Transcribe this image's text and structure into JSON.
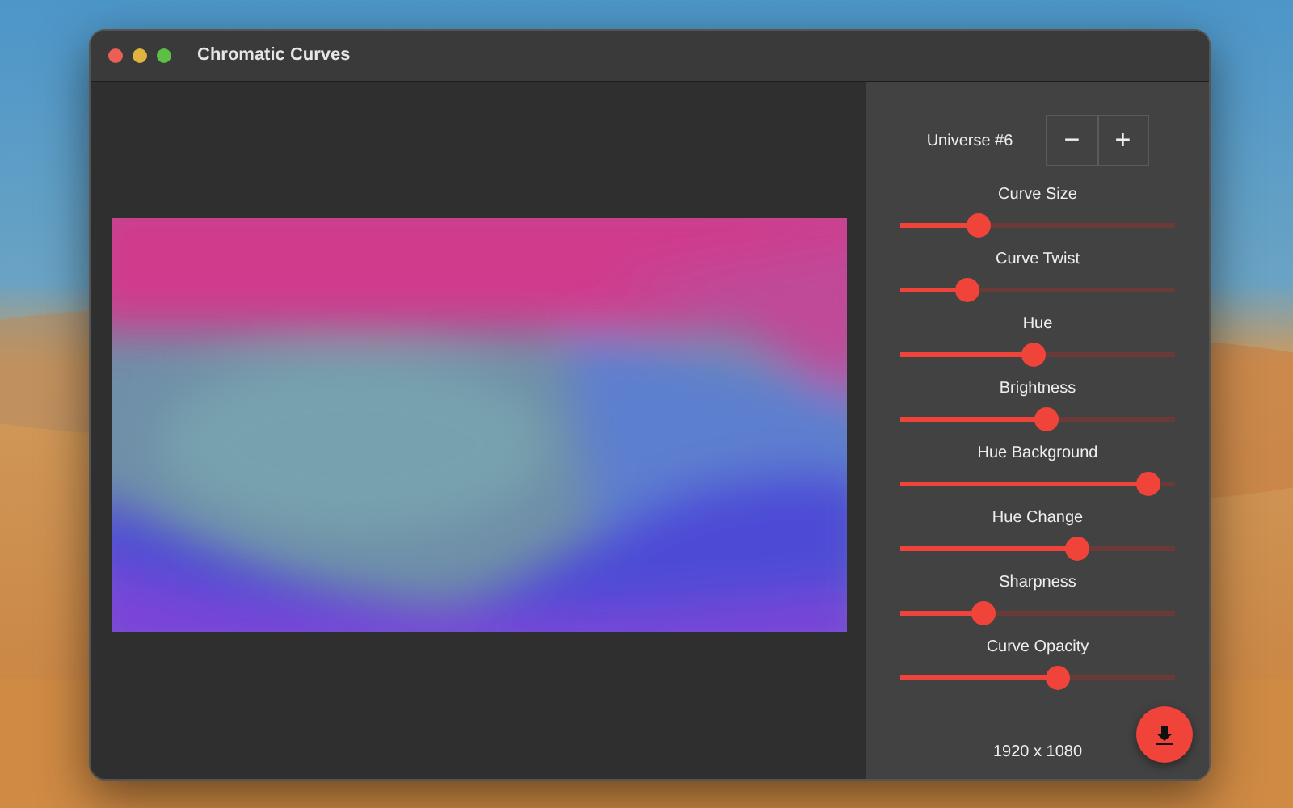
{
  "window": {
    "title": "Chromatic Curves"
  },
  "universe": {
    "label": "Universe #6",
    "buttons": [
      "−",
      "+"
    ]
  },
  "sliders": [
    {
      "label": "Curve Size",
      "level": 0.28
    },
    {
      "label": "Curve Twist",
      "level": 0.24
    },
    {
      "label": "Hue",
      "level": 0.48
    },
    {
      "label": "Brightness",
      "level": 0.53
    },
    {
      "label": "Hue Background",
      "level": 0.9
    },
    {
      "label": "Hue Change",
      "level": 0.64
    },
    {
      "label": "Sharpness",
      "level": 0.3
    },
    {
      "label": "Curve Opacity",
      "level": 0.57
    }
  ],
  "resolution": "1920 x 1080"
}
